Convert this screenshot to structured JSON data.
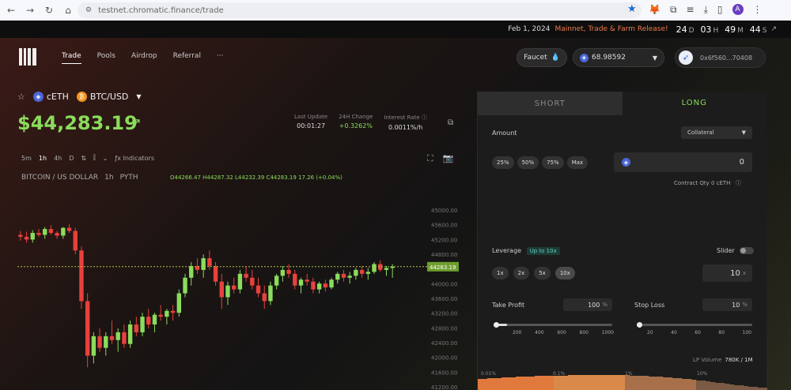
{
  "browser": {
    "url": "testnet.chromatic.finance/trade",
    "avatar_letter": "A"
  },
  "announcement": {
    "date": "Feb 1, 2024",
    "promo": "Mainnet, Trade & Farm Release!",
    "countdown": [
      {
        "v": "24",
        "u": "D"
      },
      {
        "v": "03",
        "u": "H"
      },
      {
        "v": "49",
        "u": "M"
      },
      {
        "v": "44",
        "u": "S"
      }
    ]
  },
  "nav": {
    "items": [
      "Trade",
      "Pools",
      "Airdrop",
      "Referral",
      "···"
    ],
    "active": "Trade",
    "faucet": "Faucet",
    "balance": "68.98592",
    "account": "0x6f560...70408"
  },
  "market": {
    "collateral": "cETH",
    "symbol": "BTC/USD",
    "price": "$44,283.19",
    "last_update_label": "Last Update",
    "last_update": "00:01:27",
    "change_label": "24H Change",
    "change": "+0.3262%",
    "interest_label": "Interest Rate",
    "interest": "0.0011%/h"
  },
  "chart_toolbar": {
    "intervals": [
      "5m",
      "1h",
      "4h",
      "D"
    ],
    "active_interval": "1h",
    "indicators": "Indicators"
  },
  "chart_legend": {
    "name": "BITCOIN / US DOLLAR",
    "interval": "1h",
    "source": "PYTH",
    "ohlc": "O44266.47 H44287.32 L44232.39 C44283.19 17.26 (+0.04%)"
  },
  "chart_data": {
    "type": "candlestick",
    "y_ticks": [
      "45000.00",
      "45600.00",
      "45200.00",
      "44800.00",
      "44400.00",
      "44000.00",
      "43600.00",
      "43200.00",
      "42800.00",
      "42400.00",
      "42000.00",
      "41600.00",
      "41200.00"
    ],
    "ylim": [
      41200,
      45900
    ],
    "current_price_label": "44283.19",
    "current_price": 44283.19,
    "candles": [
      [
        45100,
        45200,
        44950,
        45050
      ],
      [
        45050,
        45180,
        44900,
        44980
      ],
      [
        44980,
        45220,
        44900,
        45150
      ],
      [
        45150,
        45250,
        45050,
        45100
      ],
      [
        45100,
        45300,
        45000,
        45250
      ],
      [
        45250,
        45350,
        45100,
        45150
      ],
      [
        45150,
        45200,
        45000,
        45080
      ],
      [
        45080,
        45300,
        45000,
        45280
      ],
      [
        45280,
        45380,
        45150,
        45200
      ],
      [
        45200,
        45280,
        44600,
        44700
      ],
      [
        44700,
        44800,
        43200,
        43400
      ],
      [
        43400,
        43600,
        41700,
        42000
      ],
      [
        42000,
        42600,
        41800,
        42500
      ],
      [
        42500,
        42700,
        42100,
        42200
      ],
      [
        42200,
        42600,
        42000,
        42500
      ],
      [
        42500,
        42900,
        42300,
        42400
      ],
      [
        42400,
        42700,
        42100,
        42600
      ],
      [
        42600,
        42800,
        42200,
        42300
      ],
      [
        42300,
        42900,
        42200,
        42800
      ],
      [
        42800,
        43000,
        42500,
        42600
      ],
      [
        42600,
        43100,
        42500,
        43000
      ],
      [
        43000,
        43200,
        42700,
        42800
      ],
      [
        42800,
        43100,
        42600,
        43050
      ],
      [
        43050,
        43300,
        42900,
        43000
      ],
      [
        43000,
        43200,
        42800,
        43150
      ],
      [
        43150,
        43300,
        42900,
        43100
      ],
      [
        43100,
        43700,
        43000,
        43600
      ],
      [
        43600,
        44100,
        43500,
        44000
      ],
      [
        44000,
        44400,
        43800,
        44300
      ],
      [
        44300,
        44500,
        44100,
        44200
      ],
      [
        44200,
        44600,
        44000,
        44500
      ],
      [
        44500,
        44700,
        44200,
        44300
      ],
      [
        44300,
        44400,
        43800,
        43900
      ],
      [
        43900,
        44100,
        43200,
        43500
      ],
      [
        43500,
        43900,
        43300,
        43800
      ],
      [
        43800,
        44000,
        43600,
        43700
      ],
      [
        43700,
        44200,
        43600,
        44100
      ],
      [
        44100,
        44300,
        43900,
        44000
      ],
      [
        44000,
        44200,
        43700,
        43800
      ],
      [
        43800,
        44000,
        43500,
        43600
      ],
      [
        43600,
        43800,
        43200,
        43400
      ],
      [
        43400,
        43900,
        43300,
        43800
      ],
      [
        43800,
        44100,
        43700,
        44050
      ],
      [
        44050,
        44300,
        43900,
        44200
      ],
      [
        44200,
        44350,
        44000,
        44100
      ],
      [
        44100,
        44200,
        43700,
        43800
      ],
      [
        43800,
        44000,
        43600,
        43950
      ],
      [
        43950,
        44100,
        43800,
        43900
      ],
      [
        43900,
        44000,
        43600,
        43700
      ],
      [
        43700,
        43900,
        43600,
        43850
      ],
      [
        43850,
        43950,
        43650,
        43750
      ],
      [
        43750,
        44000,
        43700,
        43950
      ],
      [
        43950,
        44150,
        43850,
        44100
      ],
      [
        44100,
        44200,
        43900,
        44000
      ],
      [
        44000,
        44150,
        43850,
        44050
      ],
      [
        44050,
        44250,
        43950,
        44200
      ],
      [
        44200,
        44300,
        44000,
        44100
      ],
      [
        44100,
        44250,
        43950,
        44150
      ],
      [
        44150,
        44400,
        44100,
        44350
      ],
      [
        44350,
        44450,
        44150,
        44200
      ],
      [
        44200,
        44300,
        44050,
        44250
      ],
      [
        44250,
        44350,
        44000,
        44283.19
      ]
    ]
  },
  "order_panel": {
    "tab_short": "SHORT",
    "tab_long": "LONG",
    "amount_label": "Amount",
    "amount_mode": "Collateral",
    "pct_buttons": [
      "25%",
      "50%",
      "75%",
      "Max"
    ],
    "amount_value": "0",
    "contract_qty": "Contract Qty 0 cETH",
    "leverage_label": "Leverage",
    "leverage_badge": "Up to 10x",
    "slider_label": "Slider",
    "leverage_buttons": [
      "1x",
      "2x",
      "5x",
      "10x"
    ],
    "leverage_active": "10x",
    "leverage_value": "10",
    "leverage_unit": "x",
    "take_profit_label": "Take Profit",
    "take_profit_value": "100",
    "stop_loss_label": "Stop Loss",
    "stop_loss_value": "10",
    "pct_unit": "%",
    "tp_ticks": [
      "200",
      "400",
      "600",
      "800",
      "1000"
    ],
    "sl_ticks": [
      "20",
      "40",
      "60",
      "80",
      "100"
    ],
    "lp_volume_label": "LP Volume",
    "lp_volume": "780K / 1M",
    "depth_labels": [
      "0.01%",
      "0.1%",
      "1%",
      "10%"
    ]
  }
}
